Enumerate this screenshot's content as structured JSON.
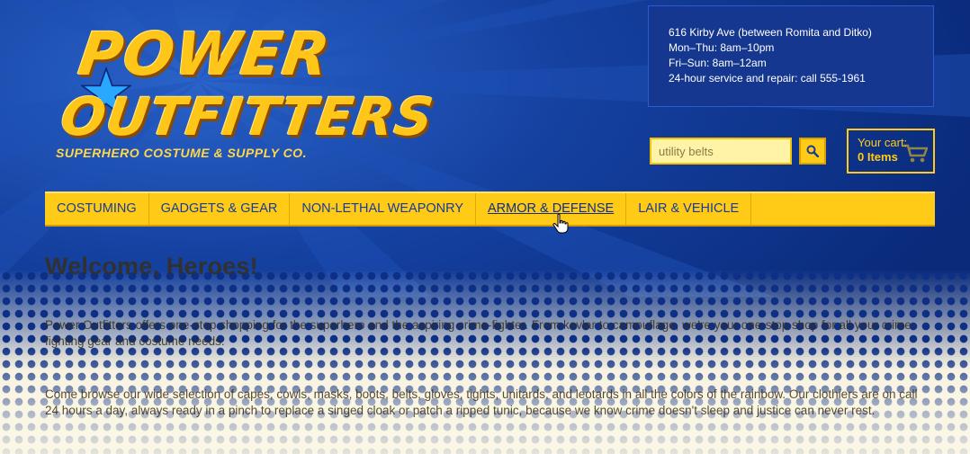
{
  "logo": {
    "line1": "POWER",
    "line2": "OUTFITTERS",
    "tagline": "SUPERHERO COSTUME & SUPPLY CO."
  },
  "info": {
    "lines": [
      "616 Kirby Ave (between Romita and Ditko)",
      "Mon–Thu: 8am–10pm",
      "Fri–Sun: 8am–12am",
      "24-hour service and repair: call 555-1961"
    ]
  },
  "search": {
    "value": "utility belts",
    "button_icon": "search-icon"
  },
  "cart": {
    "label": "Your cart:",
    "count": "0 Items",
    "icon": "cart-icon"
  },
  "nav": {
    "items": [
      {
        "label": "COSTUMING"
      },
      {
        "label": "GADGETS & GEAR"
      },
      {
        "label": "NON-LETHAL WEAPONRY"
      },
      {
        "label": "ARMOR & DEFENSE"
      },
      {
        "label": "LAIR & VEHICLE"
      }
    ],
    "active": "ARMOR & DEFENSE"
  },
  "content": {
    "heading": "Welcome, Heroes!",
    "paragraph1": "Power Outfitters offers one-stop shopping for the superhero and the aspiring crime-fighter. From kevlar to camouflage, we're your one-stop shop for all your crime-fighting gear and costume needs.",
    "paragraph2": "Come browse our wide selection of capes, cowls, masks, boots, belts, gloves, tights, unitards, and leotards in all the colors of the rainbow. Our clothiers are on call 24 hours a day, always ready in a pinch to replace a singed cloak or patch a ripped tunic, because we know crime doesn't sleep and justice can never rest."
  },
  "colors": {
    "navy": "#0a2a7a",
    "yellow": "#ffcb16",
    "info_box": "#15378f"
  }
}
